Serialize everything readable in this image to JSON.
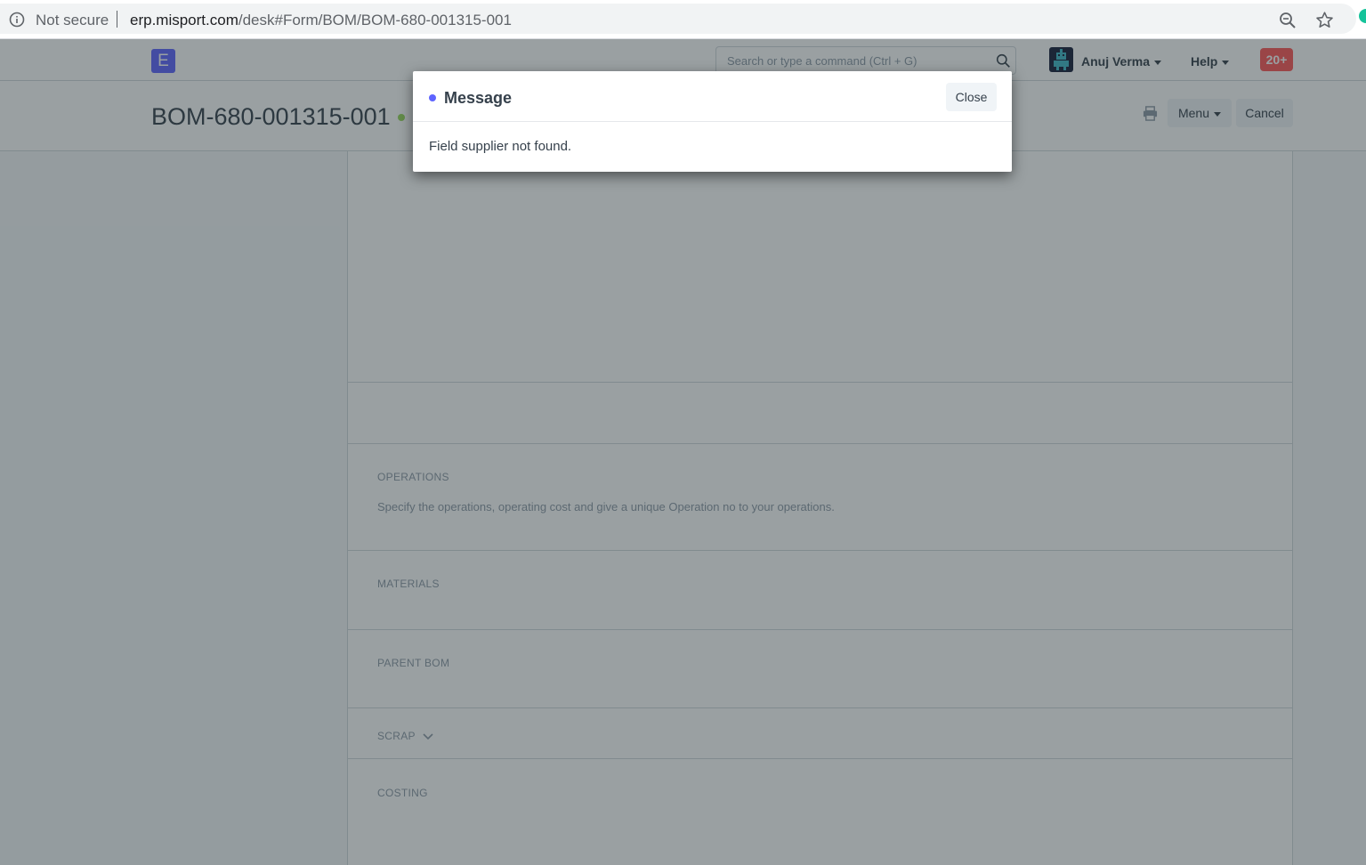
{
  "browser": {
    "security_label": "Not secure",
    "url_host": "erp.misport.com",
    "url_path": "/desk#Form/BOM/BOM-680-001315-001"
  },
  "navbar": {
    "logo_letter": "E",
    "search_placeholder": "Search or type a command (Ctrl + G)",
    "user_name": "Anuj Verma",
    "help_label": "Help",
    "notification_count": "20+"
  },
  "page_head": {
    "title": "BOM-680-001315-001",
    "menu_label": "Menu",
    "cancel_label": "Cancel"
  },
  "form": {
    "operations": {
      "heading": "OPERATIONS",
      "description": "Specify the operations, operating cost and give a unique Operation no to your operations."
    },
    "materials_heading": "MATERIALS",
    "parent_bom_heading": "PARENT BOM",
    "scrap_heading": "SCRAP",
    "costing_heading": "COSTING"
  },
  "modal": {
    "title": "Message",
    "close_label": "Close",
    "message": "Field supplier not found."
  },
  "colors": {
    "primary": "#5e64ff",
    "notification": "#ff5858",
    "status_green": "#98d85b"
  }
}
